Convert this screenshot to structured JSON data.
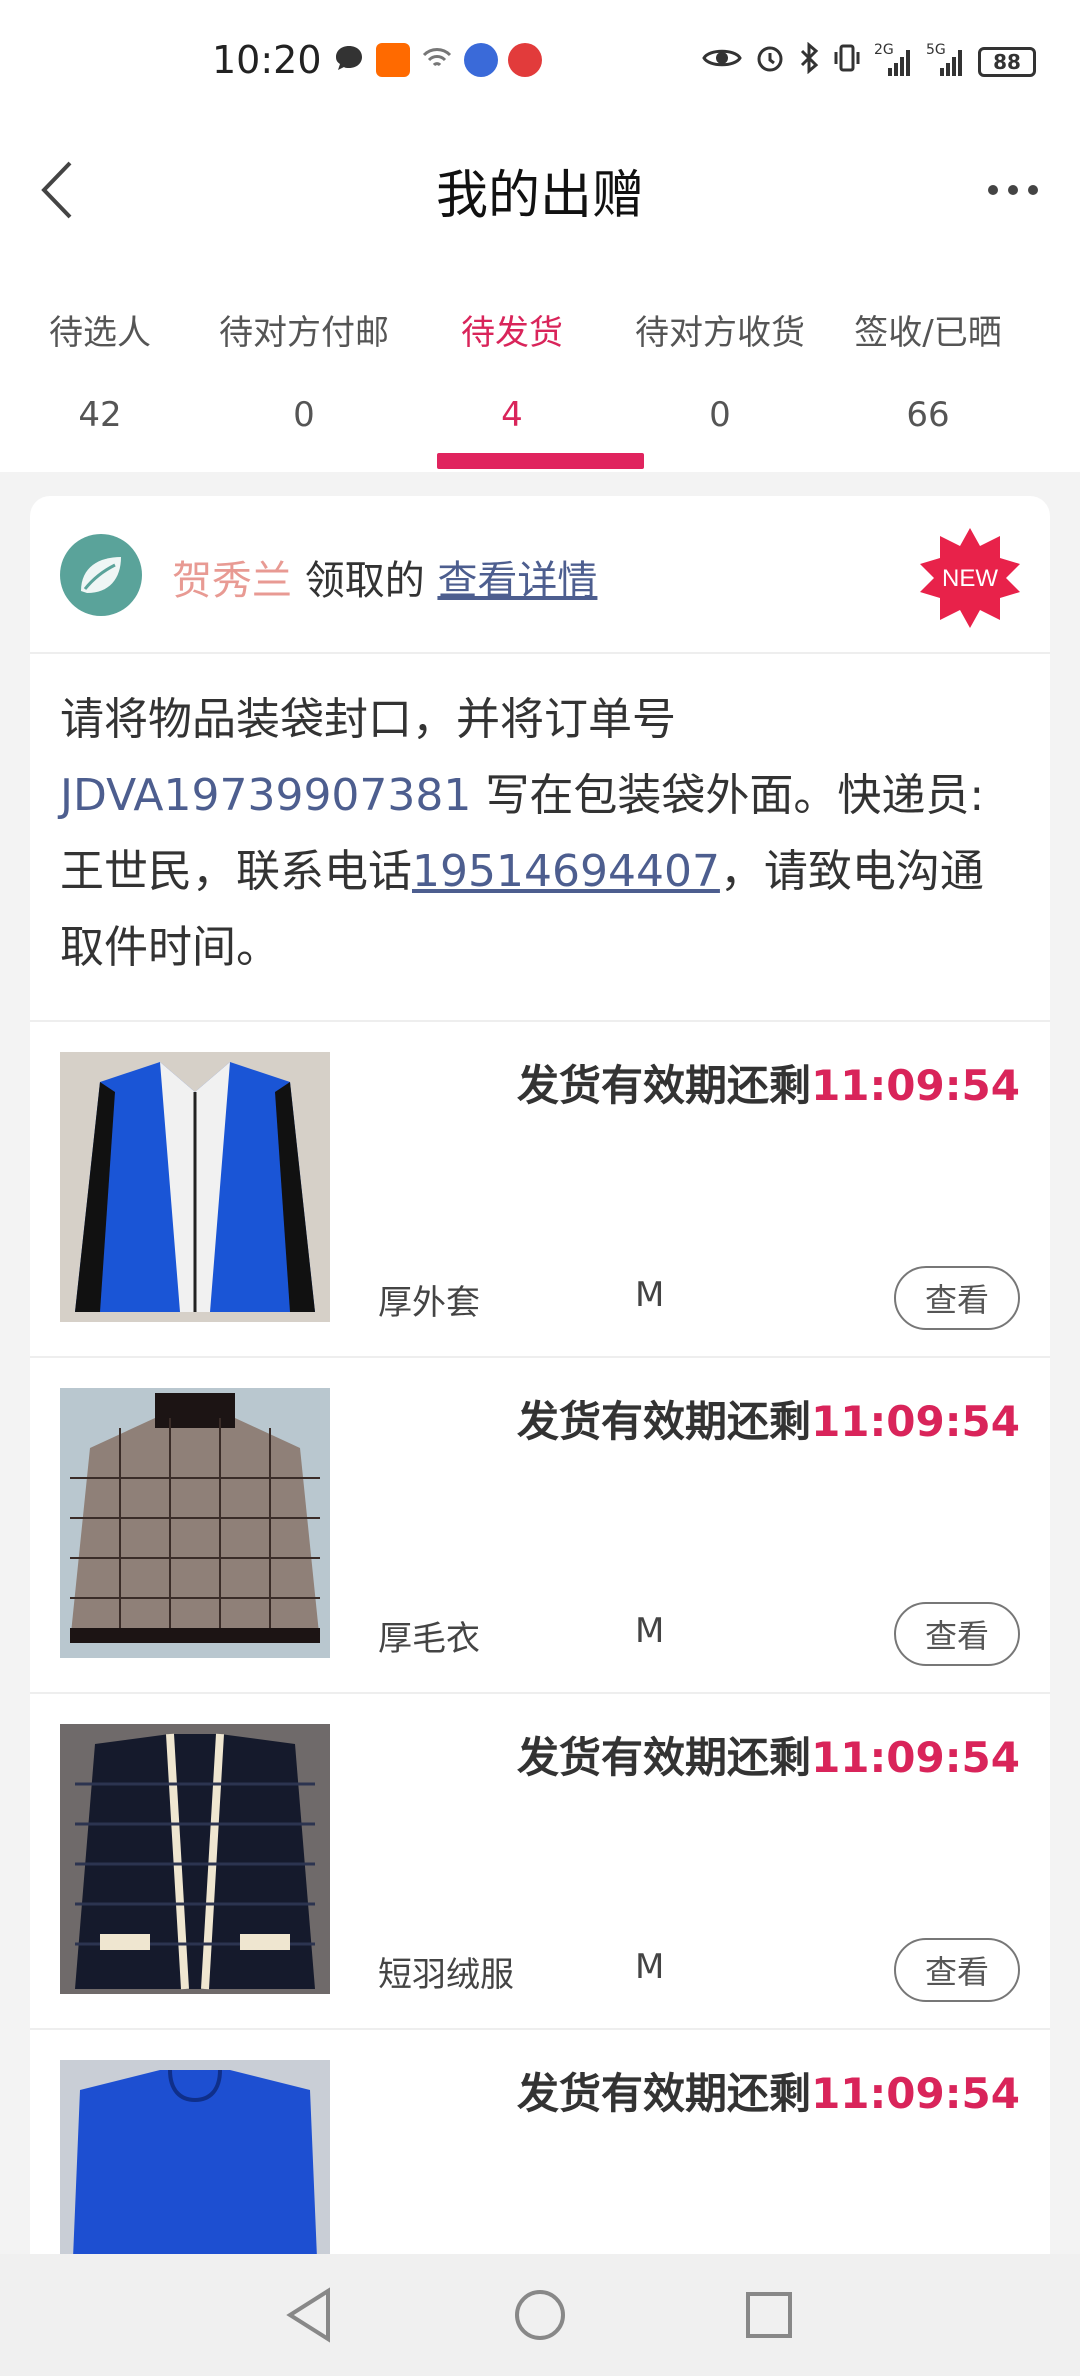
{
  "status_bar": {
    "time": "10:20",
    "battery": "88",
    "left_icons": [
      "message-icon",
      "taobao-icon",
      "wifi-hotspot-icon",
      "music-icon",
      "app-icon"
    ],
    "right_icons": [
      "eye-icon",
      "alarm-icon",
      "bluetooth-icon",
      "vibrate-icon",
      "signal-2g-icon",
      "signal-5g-icon"
    ],
    "net_labels": [
      "2G",
      "5G"
    ]
  },
  "header": {
    "title": "我的出赠"
  },
  "tabs": [
    {
      "label": "待选人",
      "count": "42"
    },
    {
      "label": "待对方付邮",
      "count": "0"
    },
    {
      "label": "待发货",
      "count": "4"
    },
    {
      "label": "待对方收货",
      "count": "0"
    },
    {
      "label": "签收/已晒",
      "count": "66"
    }
  ],
  "card": {
    "owner_name": "贺秀兰",
    "owner_suffix": " 领取的 ",
    "detail_link": "查看详情",
    "badge": "NEW",
    "instruction": {
      "part1": "请将物品装袋封口，并将订单号 ",
      "order_no": "JDVA19739907381",
      "part2": " 写在包装袋外面。快递员:王世民，联系电话",
      "phone": "19514694407",
      "part3": "，请致电沟通取件时间。"
    },
    "items": [
      {
        "countdown_label": "发货有效期还剩",
        "countdown_time": "11:09:54",
        "name": "厚外套",
        "size": "M",
        "view": "查看"
      },
      {
        "countdown_label": "发货有效期还剩",
        "countdown_time": "11:09:54",
        "name": "厚毛衣",
        "size": "M",
        "view": "查看"
      },
      {
        "countdown_label": "发货有效期还剩",
        "countdown_time": "11:09:54",
        "name": "短羽绒服",
        "size": "M",
        "view": "查看"
      },
      {
        "countdown_label": "发货有效期还剩",
        "countdown_time": "11:09:54",
        "name": "",
        "size": "",
        "view": ""
      }
    ]
  },
  "colors": {
    "accent": "#e0245e",
    "link": "#4d5e8f",
    "owner_name": "#e89a93"
  }
}
